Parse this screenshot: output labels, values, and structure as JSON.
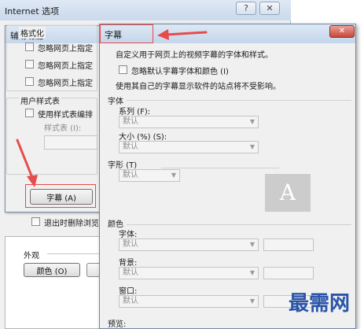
{
  "internet_options": {
    "title": "Internet 选项",
    "help_icon": "?",
    "close_icon": "✕",
    "delete_on_exit": "退出时删除浏览",
    "appearance": "外观",
    "colors_button": "颜色 (O)"
  },
  "accessibility": {
    "title": "辅助功能",
    "formatting_group": "格式化",
    "ignore_options": [
      "忽略网页上指定",
      "忽略网页上指定",
      "忽略网页上指定"
    ],
    "user_style_group": "用户样式表",
    "use_stylesheet": "使用样式表编排",
    "stylesheet_label": "样式表 (I):",
    "captions_button": "字幕 (A)"
  },
  "captions": {
    "title": "字幕",
    "close_icon": "✕",
    "description": "自定义用于网页上的视频字幕的字体和样式。",
    "ignore_default": "忽略默认字幕字体和颜色 (I)",
    "sites_note": "使用其自己的字幕显示软件的站点将不受影响。",
    "font_section": "字体",
    "family_label": "系列 (F):",
    "family_value": "默认",
    "size_label": "大小 (%) (S):",
    "size_value": "默认",
    "glyph_section": "字形 (T)",
    "glyph_value": "默认",
    "preview_letter": "A",
    "color_section": "颜色",
    "font_color_label": "字体:",
    "font_color_value": "默认",
    "background_label": "背景:",
    "background_value": "默认",
    "window_label": "窗口:",
    "window_value": "默认",
    "preview_label": "预览:"
  },
  "watermark": "最需网",
  "colors": {
    "highlight": "#e74b4b",
    "watermark": "#2a54a8",
    "close_button": "#c8473a"
  }
}
